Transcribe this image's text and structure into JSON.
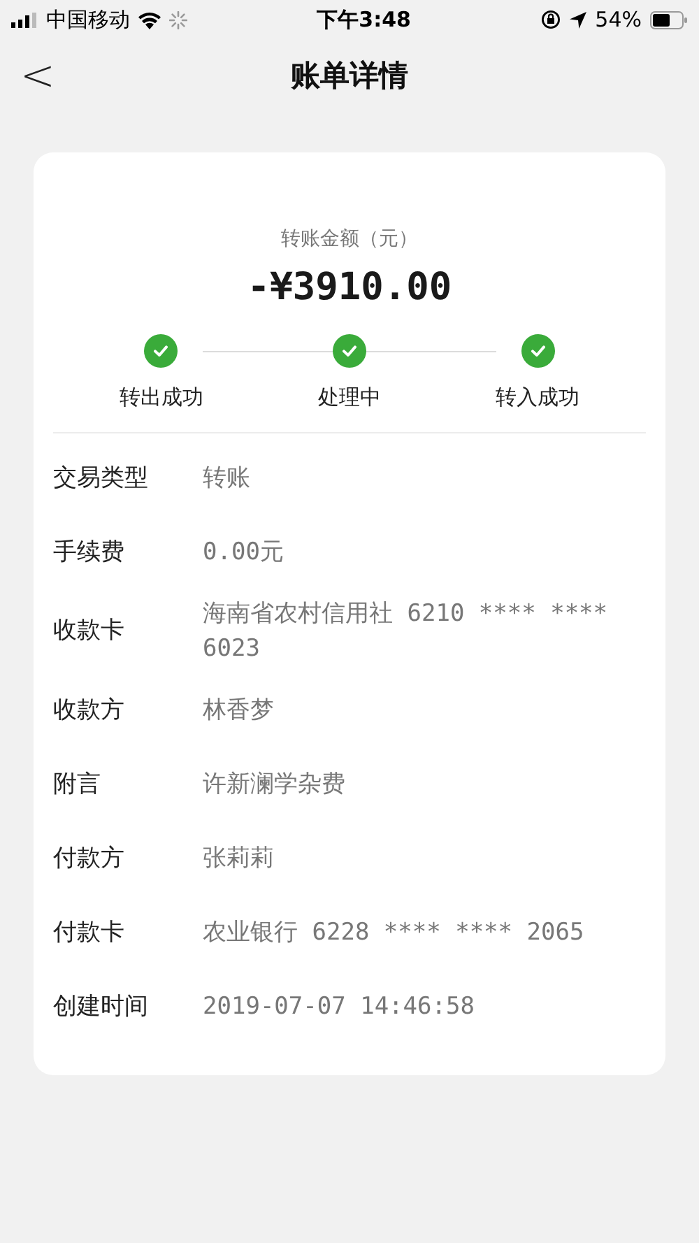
{
  "status_bar": {
    "carrier": "中国移动",
    "time": "下午3:48",
    "battery": "54%"
  },
  "header": {
    "back": "<",
    "title": "账单详情"
  },
  "amount": {
    "label": "转账金额（元）",
    "value": "-¥3910.00"
  },
  "steps": [
    {
      "label": "转出成功",
      "done": true
    },
    {
      "label": "处理中",
      "done": true
    },
    {
      "label": "转入成功",
      "done": true
    }
  ],
  "details": [
    {
      "label": "交易类型",
      "value": "转账"
    },
    {
      "label": "手续费",
      "value": "0.00元"
    },
    {
      "label": "收款卡",
      "value": "海南省农村信用社 6210 **** **** 6023"
    },
    {
      "label": "收款方",
      "value": "林香梦"
    },
    {
      "label": "附言",
      "value": "许新澜学杂费"
    },
    {
      "label": "付款方",
      "value": "张莉莉"
    },
    {
      "label": "付款卡",
      "value": "农业银行 6228 **** **** 2065"
    },
    {
      "label": "创建时间",
      "value": "2019-07-07 14:46:58"
    }
  ]
}
